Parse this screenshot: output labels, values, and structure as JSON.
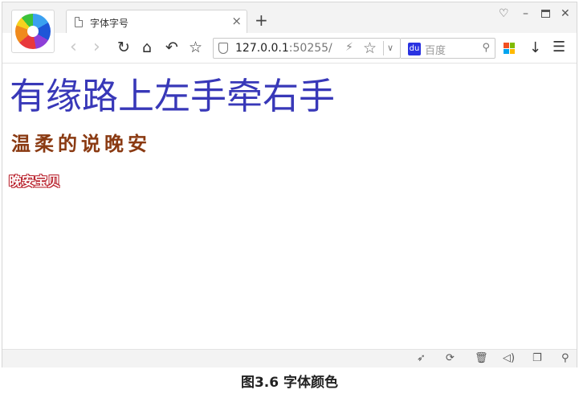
{
  "tab": {
    "title": "字体字号"
  },
  "address": {
    "host": "127.0.0.1",
    "port": ":50255/"
  },
  "search": {
    "engine": "百度"
  },
  "content": {
    "heading_blue": "有缘路上左手牵右手",
    "heading_brown": "温柔的说晚安",
    "heading_red": "晚安宝贝"
  },
  "caption": "图3.6  字体颜色",
  "colors": {
    "blue_text": "#3838b8",
    "brown_text": "#8a3a12",
    "red_outline": "#b81f2a"
  },
  "icons": {
    "tab": "page-icon",
    "back": "back-icon",
    "forward": "forward-icon",
    "reload": "reload-icon",
    "home": "home-icon",
    "undo": "undo-icon",
    "bookmark": "star-icon",
    "search_engine": "baidu-icon"
  }
}
